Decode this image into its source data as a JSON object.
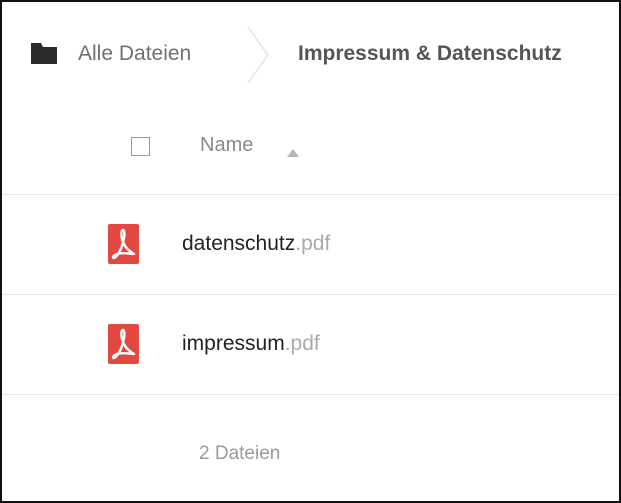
{
  "breadcrumb": {
    "root_label": "Alle Dateien",
    "current_label": "Impressum & Datenschutz",
    "root_icon": "folder-icon",
    "separator_icon": "chevron-right-icon"
  },
  "file_list": {
    "header": {
      "name_column": "Name",
      "sort_icon": "sort-ascending-icon"
    },
    "files": [
      {
        "basename": "datenschutz",
        "extension": ".pdf",
        "icon": "pdf-icon"
      },
      {
        "basename": "impressum",
        "extension": ".pdf",
        "icon": "pdf-icon"
      }
    ],
    "summary": "2 Dateien"
  },
  "colors": {
    "pdf_red": "#e2483f",
    "text_muted": "#8a8a8a",
    "divider": "#e6e6e6"
  }
}
